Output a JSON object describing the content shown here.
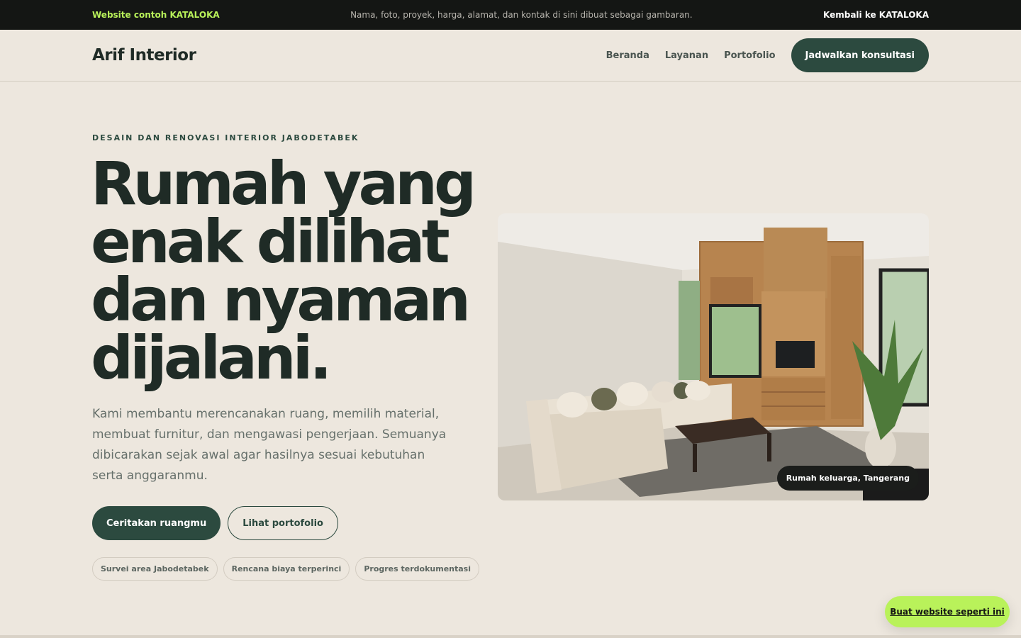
{
  "topbar": {
    "brand_note": "Website contoh KATALOKA",
    "disclaimer": "Nama, foto, proyek, harga, alamat, dan kontak di sini dibuat sebagai gambaran.",
    "back_link": "Kembali ke KATALOKA"
  },
  "header": {
    "logo": "Arif Interior",
    "nav": [
      "Beranda",
      "Layanan",
      "Portofolio"
    ],
    "cta": "Jadwalkan konsultasi"
  },
  "hero": {
    "eyebrow": "DESAIN DAN RENOVASI INTERIOR JABODETABEK",
    "headline": "Rumah yang enak dilihat dan nyaman dijalani.",
    "lead": "Kami membantu merencanakan ruang, memilih material, membuat furnitur, dan mengawasi pengerjaan. Semuanya dibicarakan sejak awal agar hasilnya sesuai kebutuhan serta anggaranmu.",
    "primary_button": "Ceritakan ruangmu",
    "secondary_button": "Lihat portofolio",
    "chips": [
      "Survei area Jabodetabek",
      "Rencana biaya terperinci",
      "Progres terdokumentasi"
    ]
  },
  "photo": {
    "caption": "Rumah keluarga, Tangerang"
  },
  "floating_cta": "Buat website seperti ini",
  "colors": {
    "accent": "#2c4a3f",
    "lime": "#b9f25a",
    "background": "#ede7de",
    "topbar": "#141614"
  }
}
